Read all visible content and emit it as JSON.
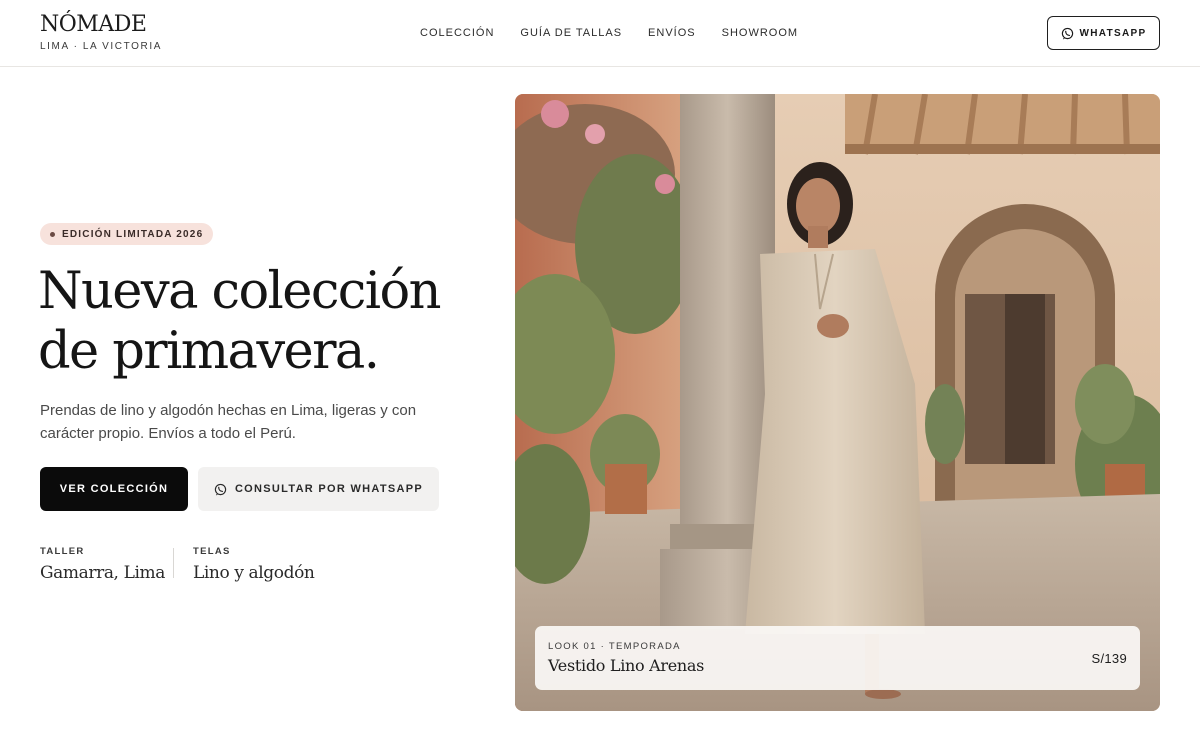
{
  "brand": {
    "name": "NÓMADE",
    "location": "LIMA · LA VICTORIA"
  },
  "nav": {
    "items": [
      "COLECCIÓN",
      "GUÍA DE TALLAS",
      "ENVÍOS",
      "SHOWROOM"
    ]
  },
  "header_cta": {
    "label": "WHATSAPP",
    "icon": "whatsapp-icon"
  },
  "hero": {
    "badge": "EDICIÓN LIMITADA 2026",
    "title": "Nueva colección de primavera.",
    "description": "Prendas de lino y algodón hechas en Lima, ligeras y con carácter propio. Envíos a todo el Perú.",
    "primary_button": "VER COLECCIÓN",
    "secondary_button": "CONSULTAR POR WHATSAPP",
    "meta": [
      {
        "label": "TALLER",
        "value": "Gamarra, Lima"
      },
      {
        "label": "TELAS",
        "value": "Lino y algodón"
      }
    ]
  },
  "look": {
    "tag": "LOOK 01 · TEMPORADA",
    "name": "Vestido Lino Arenas",
    "price": "S/139"
  },
  "colors": {
    "primary": "#0b0b0b",
    "badge_bg": "#f7e2dc",
    "secondary_bg": "#f2f1f0",
    "border": "#e8e6e3"
  }
}
